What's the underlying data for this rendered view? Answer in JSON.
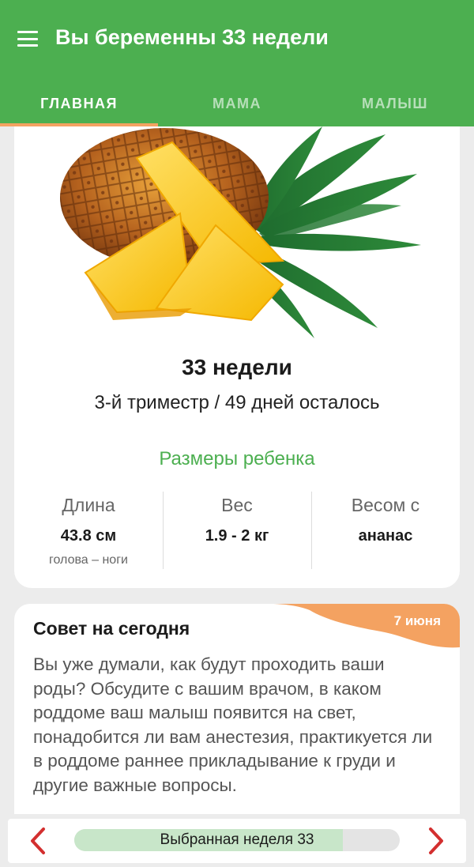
{
  "app": {
    "title": "Вы беременны 33 недели"
  },
  "tabs": [
    {
      "label": "ГЛАВНАЯ",
      "active": true
    },
    {
      "label": "МАМА",
      "active": false
    },
    {
      "label": "МАЛЫШ",
      "active": false
    }
  ],
  "summary": {
    "week_title": "33 недели",
    "trimester_line": "3-й триместр / 49 дней осталось",
    "sizes_title": "Размеры ребенка",
    "stats": [
      {
        "label": "Длина",
        "value": "43.8 см",
        "sub": "голова – ноги"
      },
      {
        "label": "Вес",
        "value": "1.9 - 2 кг",
        "sub": ""
      },
      {
        "label": "Весом с",
        "value": "ананас",
        "sub": ""
      }
    ]
  },
  "tip": {
    "title": "Совет на сегодня",
    "date": "7 июня",
    "text": "Вы уже думали, как будут проходить ваши роды? Обсудите с вашим врачом, в каком роддоме ваш малыш появится на свет, понадобится ли вам анестезия, практикуется ли в роддоме раннее прикладывание к груди и другие важные вопросы."
  },
  "week_selector": {
    "label": "Выбранная неделя 33",
    "progress": 0.825
  },
  "colors": {
    "primary": "#4caf50",
    "accent": "#f4a261",
    "arrow": "#d32f2f",
    "selector_fill": "#c8e6c9"
  },
  "icons": {
    "menu": "hamburger-icon",
    "prev": "chevron-left-icon",
    "next": "chevron-right-icon",
    "fruit": "pineapple-image"
  }
}
